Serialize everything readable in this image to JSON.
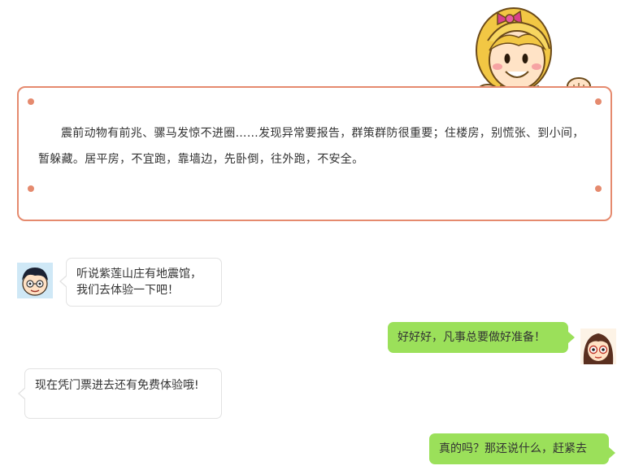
{
  "notice": {
    "text": "震前动物有前兆、骡马发惊不进圈……发现异常要报告，群策群防很重要；住楼房，别慌张、到小间，暂躲藏。居平房，不宜跑，靠墙边，先卧倒，往外跑，不安全。",
    "border_color": "#e58a6e"
  },
  "chat": {
    "messages": [
      {
        "sender": "boy",
        "side": "left",
        "text": "听说紫莲山庄有地震馆，我们去体验一下吧！"
      },
      {
        "sender": "girl",
        "side": "right",
        "text": "好好好，凡事总要做好准备！"
      },
      {
        "sender": "boy",
        "side": "left",
        "text": "现在凭门票进去还有免费体验哦!"
      },
      {
        "sender": "girl",
        "side": "right",
        "text": "真的吗？那还说什么，赶紧去"
      }
    ],
    "bubble_green": "#9be05a",
    "bubble_white_border": "#e2e2e2"
  },
  "icons": {
    "mascot": "cartoon-girl-peeking-icon",
    "boy_avatar": "boy-avatar-icon",
    "girl_avatar": "girl-avatar-icon"
  }
}
